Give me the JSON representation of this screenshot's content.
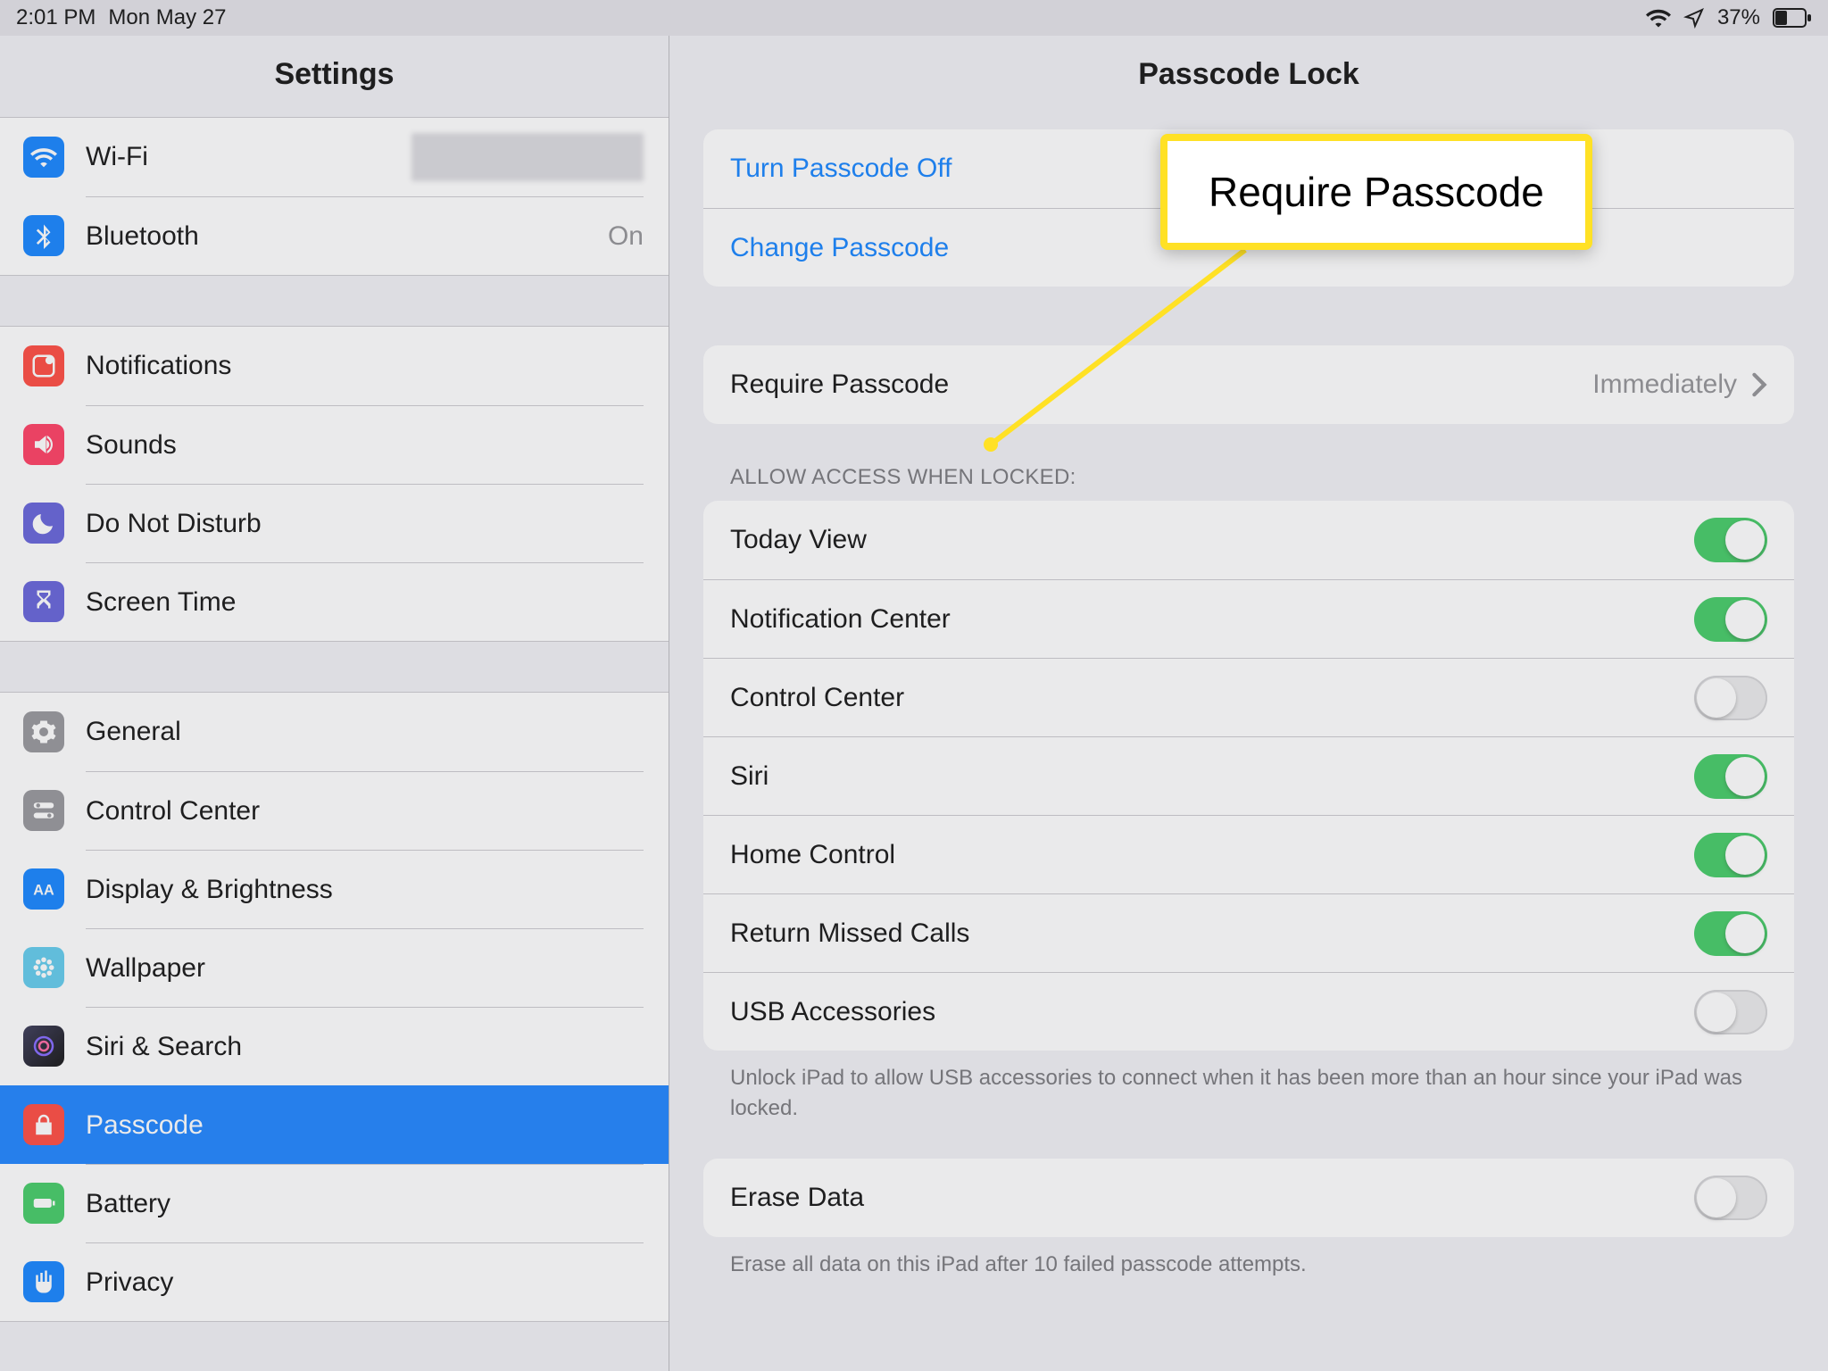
{
  "statusbar": {
    "time": "2:01 PM",
    "date": "Mon May 27",
    "battery_pct": "37%"
  },
  "sidebar": {
    "title": "Settings",
    "items": [
      {
        "label": "Wi-Fi",
        "value": ""
      },
      {
        "label": "Bluetooth",
        "value": "On"
      },
      {
        "label": "Notifications"
      },
      {
        "label": "Sounds"
      },
      {
        "label": "Do Not Disturb"
      },
      {
        "label": "Screen Time"
      },
      {
        "label": "General"
      },
      {
        "label": "Control Center"
      },
      {
        "label": "Display & Brightness"
      },
      {
        "label": "Wallpaper"
      },
      {
        "label": "Siri & Search"
      },
      {
        "label": "Passcode"
      },
      {
        "label": "Battery"
      },
      {
        "label": "Privacy"
      }
    ]
  },
  "detail": {
    "title": "Passcode Lock",
    "actions": {
      "turn_off": "Turn Passcode Off",
      "change": "Change Passcode"
    },
    "require": {
      "label": "Require Passcode",
      "value": "Immediately"
    },
    "allow_header": "ALLOW ACCESS WHEN LOCKED:",
    "allow_items": [
      {
        "label": "Today View",
        "on": true
      },
      {
        "label": "Notification Center",
        "on": true
      },
      {
        "label": "Control Center",
        "on": false
      },
      {
        "label": "Siri",
        "on": true
      },
      {
        "label": "Home Control",
        "on": true
      },
      {
        "label": "Return Missed Calls",
        "on": true
      },
      {
        "label": "USB Accessories",
        "on": false
      }
    ],
    "usb_note": "Unlock iPad to allow USB accessories to connect when it has been more than an hour since your iPad was locked.",
    "erase": {
      "label": "Erase Data",
      "on": false
    },
    "erase_note": "Erase all data on this iPad after 10 failed passcode attempts."
  },
  "callout": {
    "text": "Require Passcode"
  }
}
